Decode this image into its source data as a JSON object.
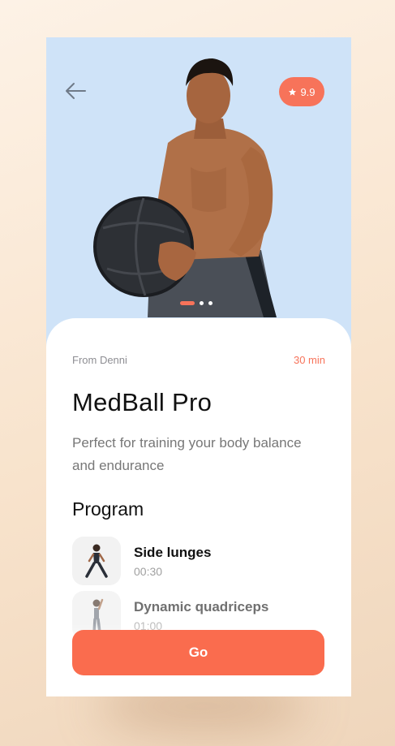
{
  "header": {
    "back_icon": "arrow-left-icon",
    "rating_icon": "star-icon",
    "rating": "9.9",
    "carousel": {
      "count": 3,
      "active_index": 0
    }
  },
  "workout": {
    "author": "From Denni",
    "duration": "30 min",
    "title": "MedBall Pro",
    "description": "Perfect for training your body balance and endurance"
  },
  "program": {
    "title": "Program",
    "items": [
      {
        "name": "Side lunges",
        "time": "00:30",
        "icon": "exercise-thumbnail-icon"
      },
      {
        "name": "Dynamic  quadriceps",
        "time": "01:00",
        "icon": "exercise-thumbnail-icon"
      }
    ]
  },
  "actions": {
    "go_label": "Go"
  },
  "colors": {
    "accent": "#f7735a",
    "hero_bg": "#cfe3f8",
    "page_bg": "#fbe8d4"
  }
}
